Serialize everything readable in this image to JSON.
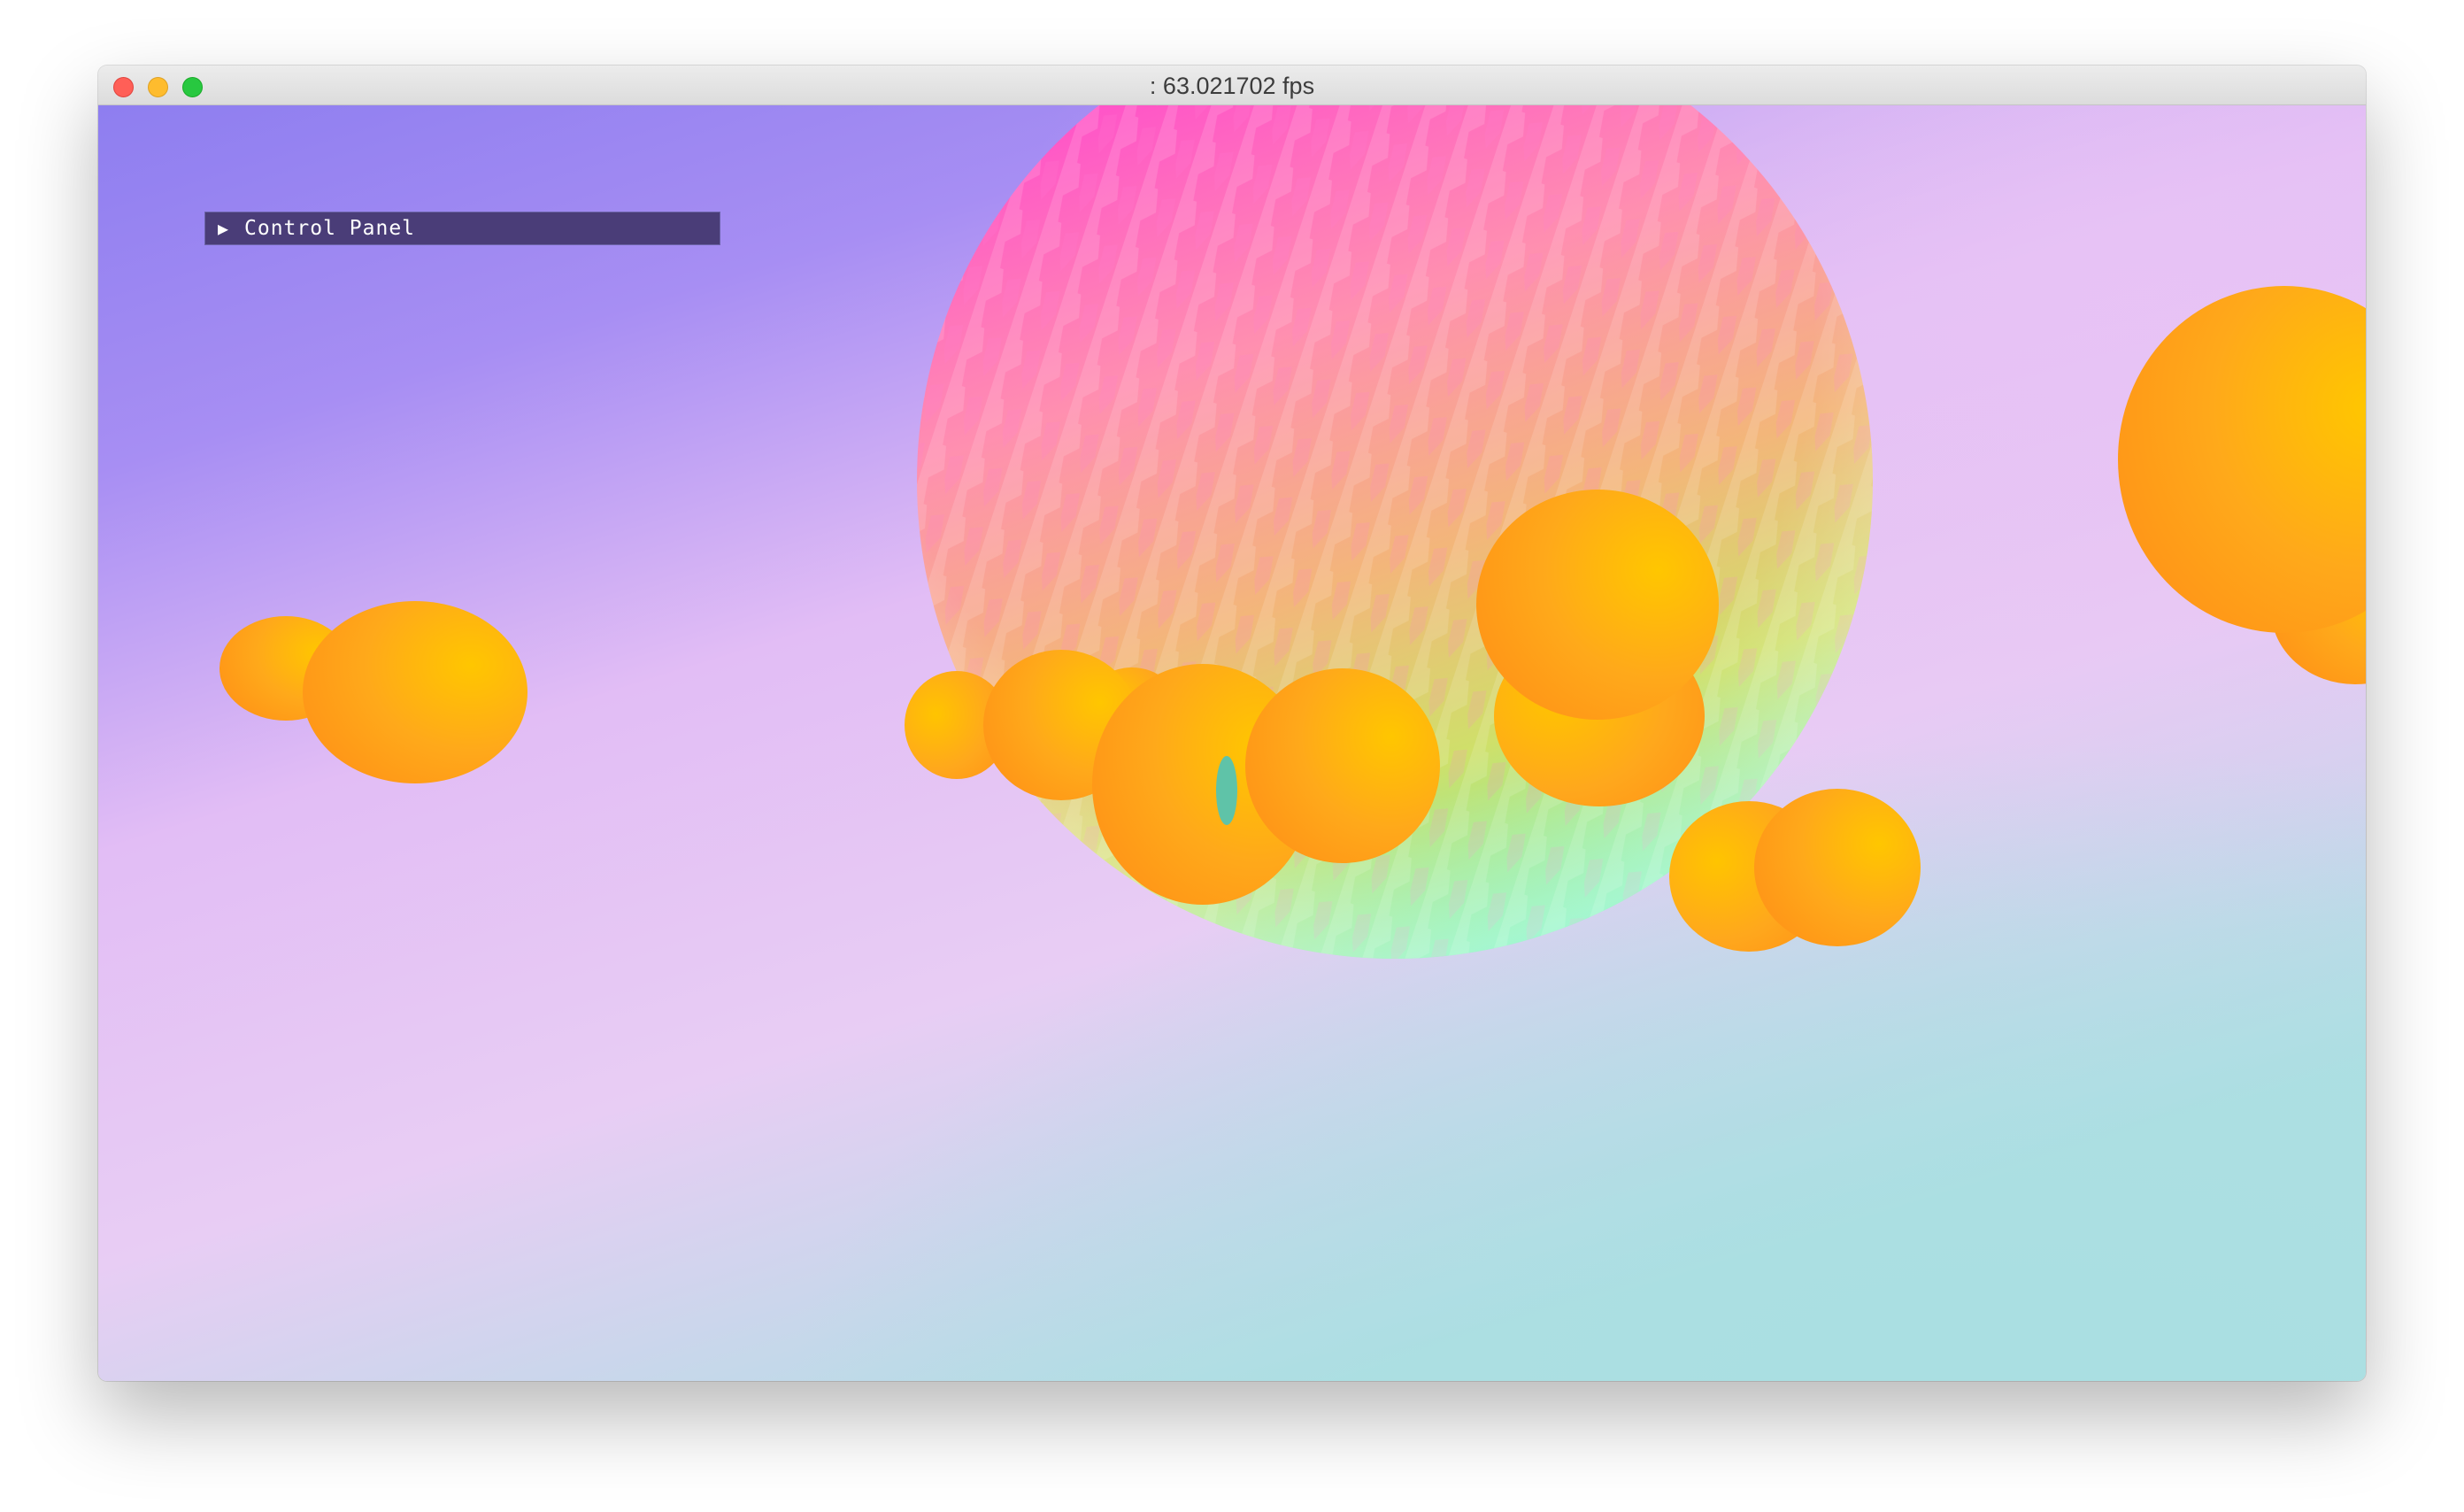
{
  "window": {
    "title": ": 63.021702 fps"
  },
  "control_panel": {
    "label": "Control Panel",
    "arrow_icon": "triangle-right-icon",
    "expanded": false
  },
  "scene": {
    "background_gradient": [
      "#8e7ef0",
      "#b99cf2",
      "#e7c3f4",
      "#e6cdf3",
      "#bde0e7",
      "#aedfe2"
    ],
    "large_sphere_colors": [
      "#ff4fd0",
      "#ff9fa0",
      "#f3c86a",
      "#cfe36d",
      "#7cf0b2"
    ],
    "small_sphere_color": "#ffa514",
    "small_sphere_highlight": "#ffc400"
  }
}
